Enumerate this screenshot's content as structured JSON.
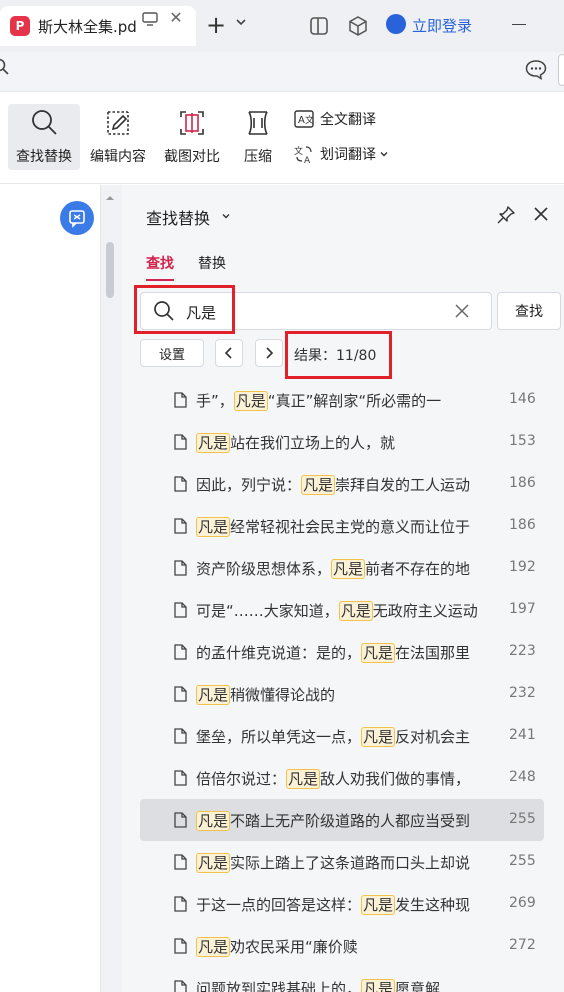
{
  "tab": {
    "title": "斯大林全集.pdf",
    "logo": "P"
  },
  "login": {
    "label": "立即登录"
  },
  "toolbar": {
    "find_replace": "查找替换",
    "edit_content": "编辑内容",
    "screenshot_compare": "截图对比",
    "compress": "压缩",
    "full_translate": "全文翻译",
    "word_translate": "划词翻译"
  },
  "panel": {
    "title": "查找替换",
    "tab_find": "查找",
    "tab_replace": "替换",
    "search_value": "凡是",
    "find_button": "查找",
    "settings_button": "设置",
    "result_label": "结果：11/80"
  },
  "results": [
    {
      "pre": "手”，",
      "hit": "凡是",
      "post": "“真正”解剖家“所必需的一",
      "page": "146"
    },
    {
      "pre": "",
      "hit": "凡是",
      "post": "站在我们立场上的人，就",
      "page": "153"
    },
    {
      "pre": "因此，列宁说：",
      "hit": "凡是",
      "post": "崇拜自发的工人运动",
      "page": "186"
    },
    {
      "pre": "",
      "hit": "凡是",
      "post": "经常轻视社会民主党的意义而让位于",
      "page": "186"
    },
    {
      "pre": "资产阶级思想体系，",
      "hit": "凡是",
      "post": "前者不存在的地",
      "page": "192"
    },
    {
      "pre": "可是“……大家知道，",
      "hit": "凡是",
      "post": "无政府主义运动",
      "page": "197"
    },
    {
      "pre": "的孟什维克说道：是的，",
      "hit": "凡是",
      "post": "在法国那里",
      "page": "223"
    },
    {
      "pre": "",
      "hit": "凡是",
      "post": "稍微懂得论战的",
      "page": "232"
    },
    {
      "pre": "堡垒，所以单凭这一点，",
      "hit": "凡是",
      "post": "反对机会主",
      "page": "241"
    },
    {
      "pre": "倍倍尔说过：",
      "hit": "凡是",
      "post": "敌人劝我们做的事情，",
      "page": "248"
    },
    {
      "pre": "",
      "hit": "凡是",
      "post": "不踏上无产阶级道路的人都应当受到",
      "page": "255"
    },
    {
      "pre": "",
      "hit": "凡是",
      "post": "实际上踏上了这条道路而口头上却说",
      "page": "255"
    },
    {
      "pre": "于这一点的回答是这样：",
      "hit": "凡是",
      "post": "发生这种现",
      "page": "269"
    },
    {
      "pre": "",
      "hit": "凡是",
      "post": "劝农民采用“廉价赎",
      "page": "272"
    },
    {
      "pre": "问题放到实践基础上的，",
      "hit": "凡是",
      "post": "愿意解",
      "page": ""
    }
  ],
  "colors": {
    "accent_red": "#d4234a",
    "highlight_border": "#e0212a",
    "brand_blue": "#2a63d9"
  }
}
